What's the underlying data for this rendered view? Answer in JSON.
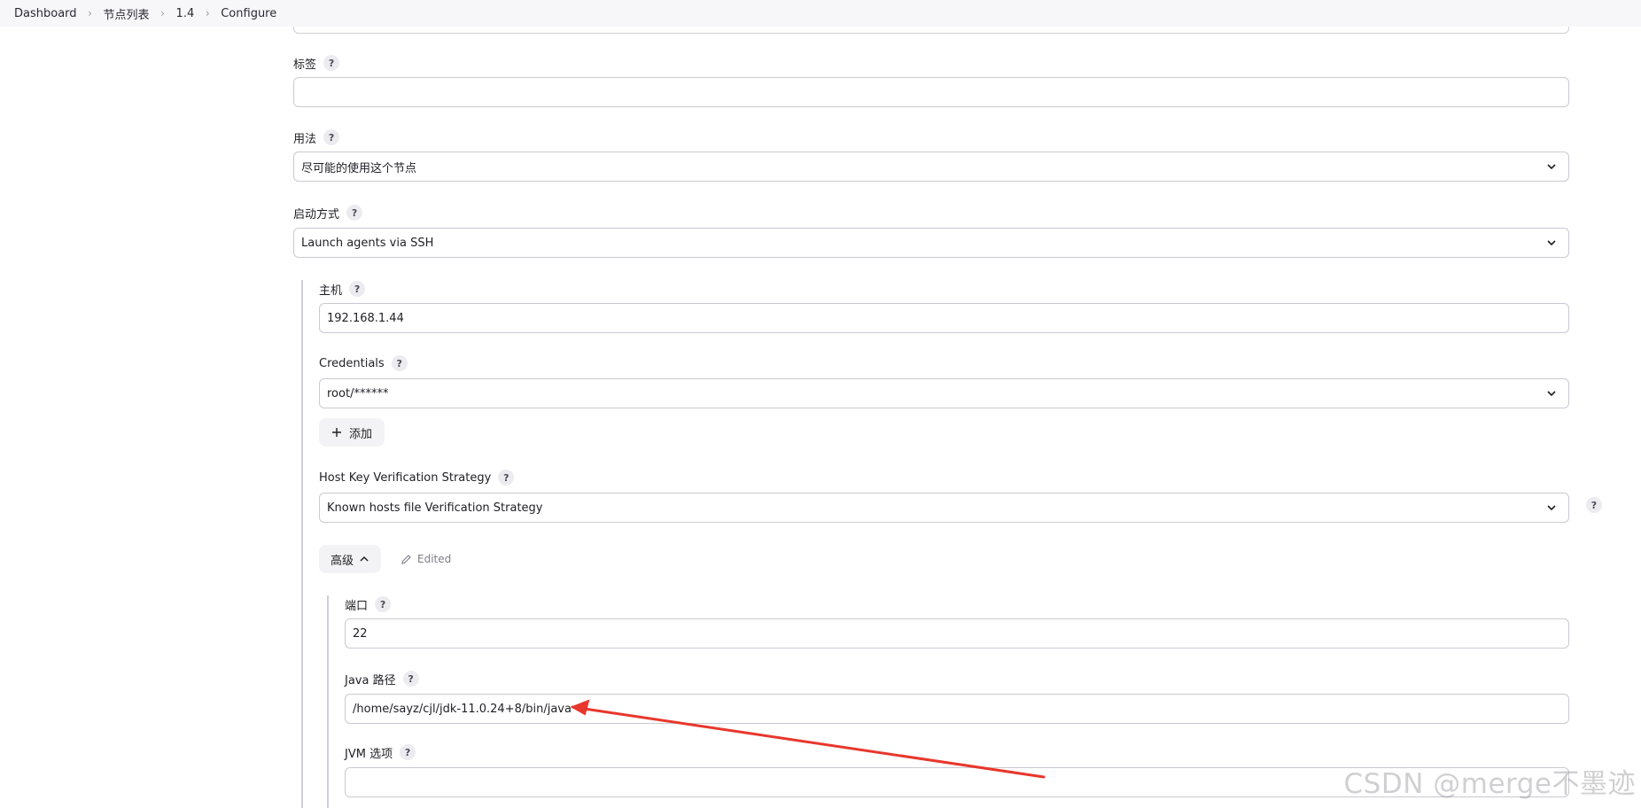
{
  "breadcrumb": {
    "items": [
      "Dashboard",
      "节点列表",
      "1.4",
      "Configure"
    ]
  },
  "fields": {
    "labels": {
      "label": "标签",
      "value": ""
    },
    "usage": {
      "label": "用法",
      "value": "尽可能的使用这个节点"
    },
    "launch_method": {
      "label": "启动方式",
      "value": "Launch agents via SSH"
    },
    "host": {
      "label": "主机",
      "value": "192.168.1.44"
    },
    "credentials": {
      "label": "Credentials",
      "value": "root/******"
    },
    "host_key": {
      "label": "Host Key Verification Strategy",
      "value": "Known hosts file Verification Strategy"
    },
    "port": {
      "label": "端口",
      "value": "22"
    },
    "java_path": {
      "label": "Java 路径",
      "value": "/home/sayz/cjl/jdk-11.0.24+8/bin/java"
    },
    "jvm_options": {
      "label": "JVM 选项",
      "value": ""
    }
  },
  "buttons": {
    "add_label": "添加",
    "advanced_label": "高级",
    "edited_label": "Edited"
  },
  "help_glyph": "?",
  "watermark": "CSDN @merge不墨迹",
  "colors": {
    "annotation_arrow": "#e8372c",
    "border": "#c9cad1",
    "help_bg": "#ececf0"
  }
}
